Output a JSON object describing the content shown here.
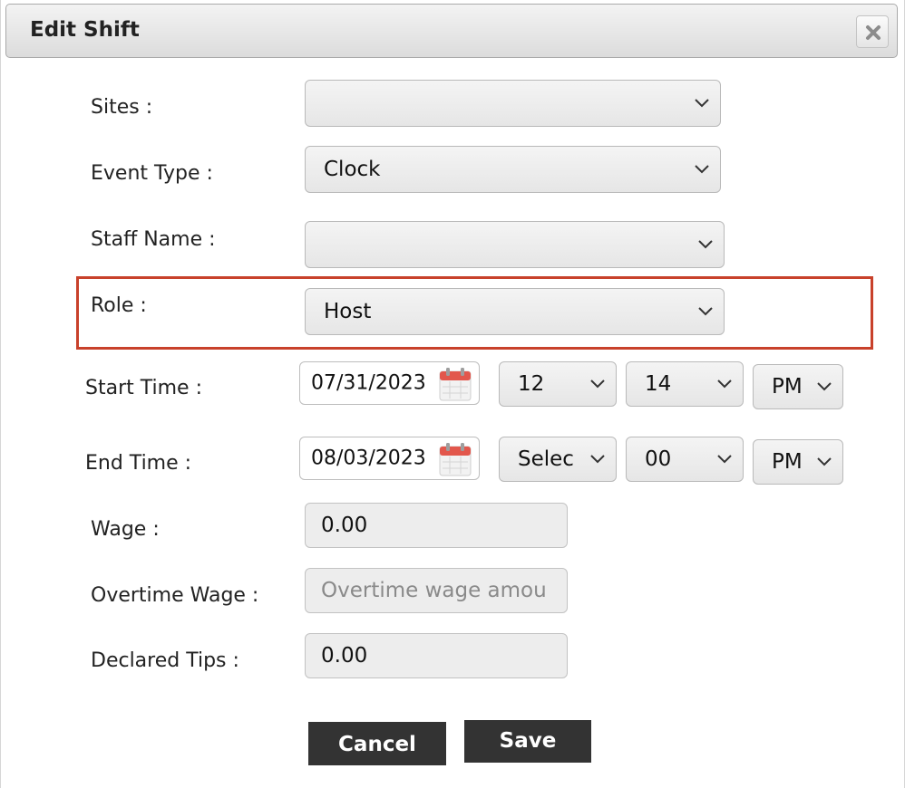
{
  "dialog": {
    "title": "Edit Shift"
  },
  "form": {
    "sites": {
      "label": "Sites :",
      "value": ""
    },
    "event_type": {
      "label": "Event Type :",
      "value": "Clock"
    },
    "staff_name": {
      "label": "Staff Name :",
      "value": ""
    },
    "role": {
      "label": "Role :",
      "value": "Host"
    },
    "start_time": {
      "label": "Start Time :",
      "date": "07/31/2023",
      "hour": "12",
      "minute": "14",
      "ampm": "PM"
    },
    "end_time": {
      "label": "End Time :",
      "date": "08/03/2023",
      "hour": "Selec",
      "minute": "00",
      "ampm": "PM"
    },
    "wage": {
      "label": "Wage :",
      "value": "0.00"
    },
    "overtime_wage": {
      "label": "Overtime Wage :",
      "value": "",
      "placeholder": "Overtime wage amou"
    },
    "declared_tips": {
      "label": "Declared Tips :",
      "value": "0.00"
    }
  },
  "buttons": {
    "cancel": "Cancel",
    "save": "Save"
  },
  "colors": {
    "highlight": "#c8412b",
    "button_bg": "#333333"
  }
}
